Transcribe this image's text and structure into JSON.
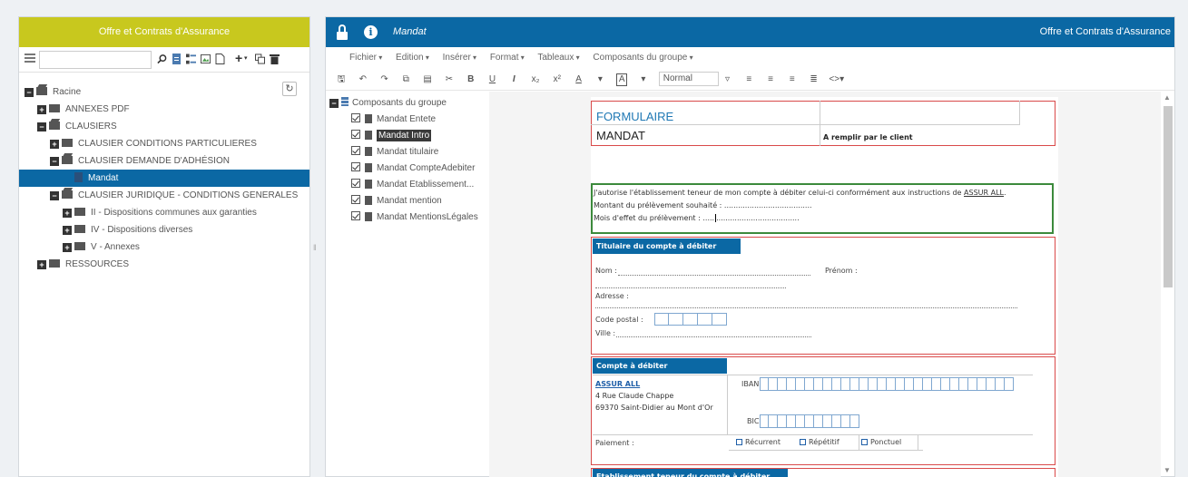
{
  "left_panel": {
    "title": "Offre et Contrats d'Assurance",
    "tree": [
      {
        "label": "Racine",
        "level": 0,
        "toggle": "−",
        "icon": "folder-open"
      },
      {
        "label": "ANNEXES PDF",
        "level": 1,
        "toggle": "+",
        "icon": "folder"
      },
      {
        "label": "CLAUSIERS",
        "level": 1,
        "toggle": "−",
        "icon": "folder-open"
      },
      {
        "label": "CLAUSIER CONDITIONS PARTICULIERES",
        "level": 2,
        "toggle": "+",
        "icon": "folder"
      },
      {
        "label": "CLAUSIER DEMANDE D'ADHÉSION",
        "level": 2,
        "toggle": "−",
        "icon": "folder-open"
      },
      {
        "label": "Mandat",
        "level": 3,
        "toggle": "",
        "icon": "document",
        "selected": true
      },
      {
        "label": "CLAUSIER JURIDIQUE - CONDITIONS GENERALES",
        "level": 2,
        "toggle": "−",
        "icon": "folder-open"
      },
      {
        "label": "II - Dispositions communes aux garanties",
        "level": 3,
        "toggle": "+",
        "icon": "folder"
      },
      {
        "label": "IV - Dispositions diverses",
        "level": 3,
        "toggle": "+",
        "icon": "folder"
      },
      {
        "label": "V - Annexes",
        "level": 3,
        "toggle": "+",
        "icon": "folder"
      },
      {
        "label": "RESSOURCES",
        "level": 1,
        "toggle": "+",
        "icon": "folder"
      }
    ]
  },
  "right_panel": {
    "title": "Mandat",
    "right_title": "Offre et Contrats d'Assurance",
    "menu": [
      "Fichier",
      "Edition",
      "Insérer",
      "Format",
      "Tableaux",
      "Composants du groupe"
    ],
    "style_select": "Normal",
    "components": {
      "header": "Composants du groupe",
      "items": [
        "Mandat Entete",
        "Mandat Intro",
        "Mandat titulaire",
        "Mandat CompteAdebiter",
        "Mandat Etablissement...",
        "Mandat mention",
        "Mandat MentionsLégales"
      ],
      "selected_index": 1
    }
  },
  "document": {
    "form_title": "FORMULAIRE",
    "form_subtitle": "MANDAT",
    "form_right": "A remplir par le client",
    "intro_line1_prefix": "J'autorise l'établissement teneur de mon compte à débiter celui-ci conformément aux instructions de ",
    "intro_line1_link": "ASSUR ALL",
    "intro_line1_suffix": ".",
    "intro_line2": "Montant du prélèvement souhaité : ......................................",
    "intro_line3": "Mois d'effet du prélèvement : .....",
    "section_titulaire": "Titulaire du compte à débiter",
    "nom_label": "Nom :",
    "prenom_label": "Prénom :",
    "adresse_label": "Adresse :",
    "cp_label": "Code postal :",
    "ville_label": "Ville :",
    "section_compte": "Compte à débiter",
    "bank_name": "ASSUR ALL",
    "bank_addr1": "4 Rue Claude Chappe",
    "bank_addr2": "69370 Saint-Didier au Mont d'Or",
    "iban_label": "IBAN",
    "bic_label": "BIC",
    "paiement_label": "Paiement :",
    "opt_recurrent": "Récurrent",
    "opt_repetitif": "Répétitif",
    "opt_ponctuel": "Ponctuel",
    "section_etab": "Etablissement teneur du compte à débiter"
  },
  "colors": {
    "accent_left": "#c8c81e",
    "accent_right": "#0b68a4",
    "selection": "#0b68a4"
  }
}
